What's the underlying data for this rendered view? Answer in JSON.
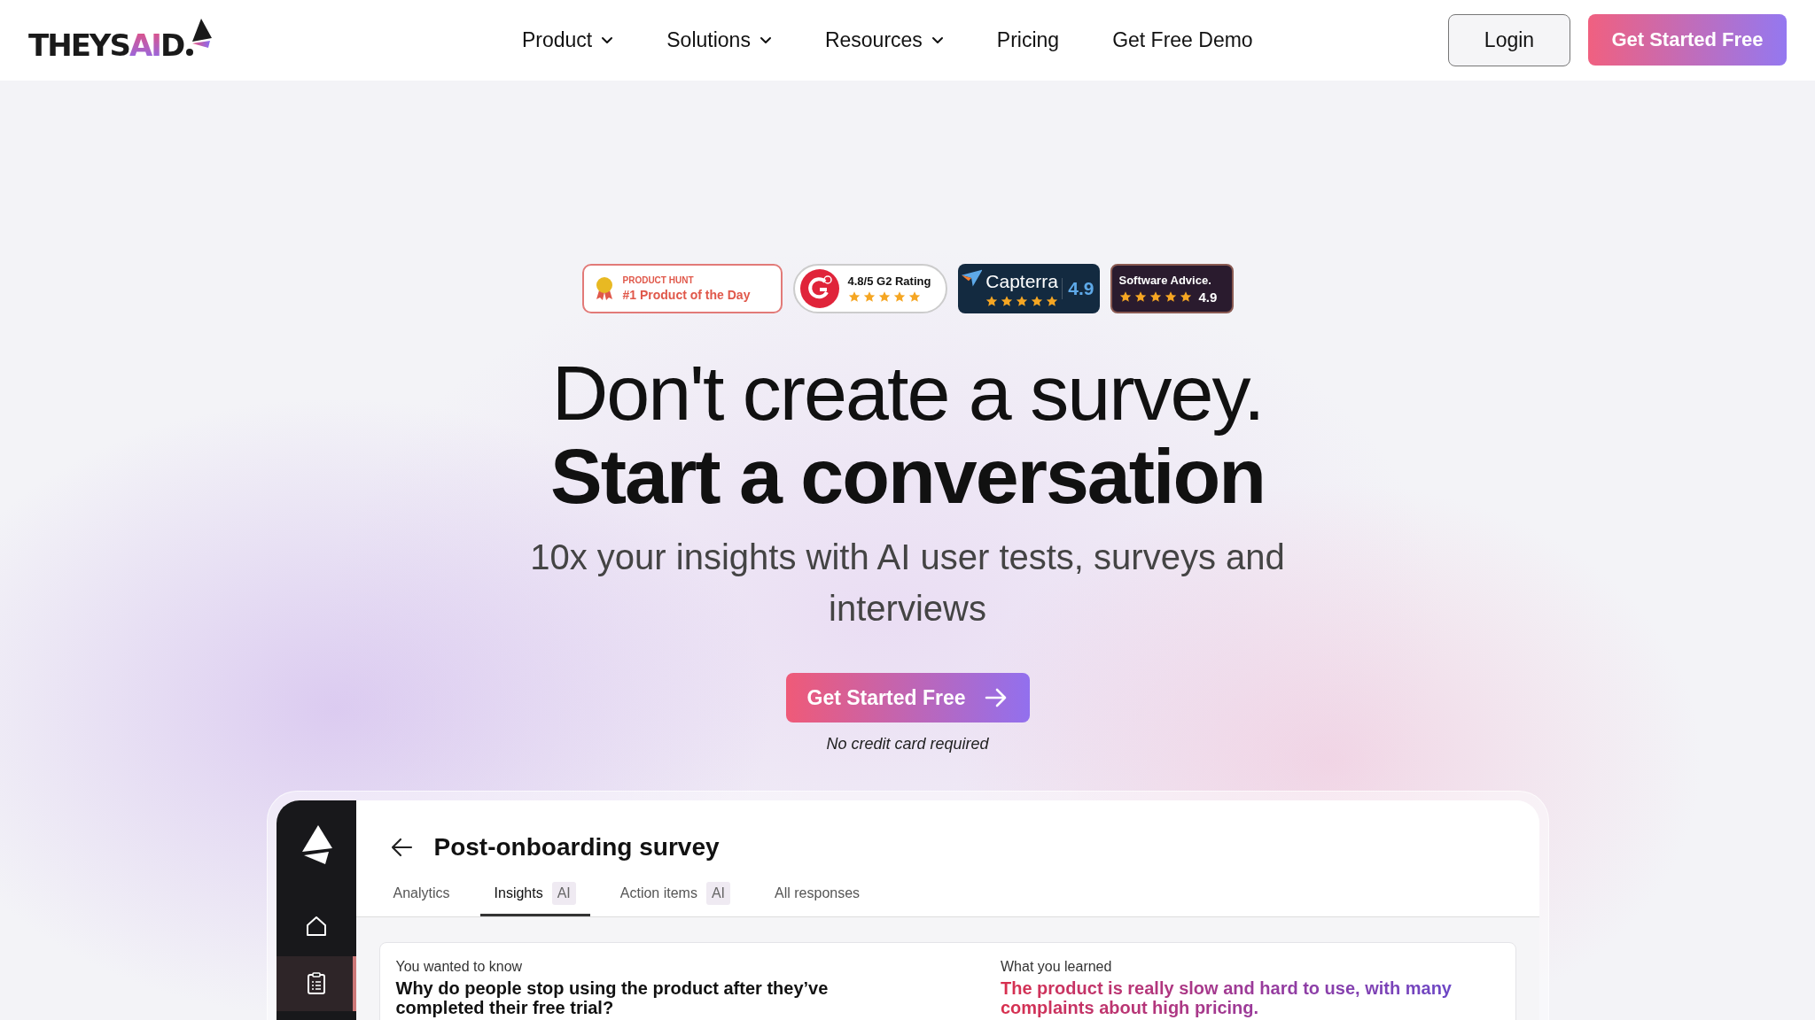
{
  "header": {
    "logo": [
      {
        "text": "THEYS",
        "accent": false
      },
      {
        "text": "AI",
        "accent": true
      },
      {
        "text": "D",
        "accent": false
      }
    ],
    "nav": [
      {
        "label": "Product",
        "dropdown": true
      },
      {
        "label": "Solutions",
        "dropdown": true
      },
      {
        "label": "Resources",
        "dropdown": true
      },
      {
        "label": "Pricing",
        "dropdown": false
      },
      {
        "label": "Get Free Demo",
        "dropdown": false
      }
    ],
    "login": "Login",
    "cta": "Get Started Free"
  },
  "badges": [
    {
      "kind": "product-hunt",
      "title": "PRODUCT HUNT",
      "text": "#1 Product of the Day"
    },
    {
      "kind": "g2",
      "title": "4.8/5 G2 Rating",
      "stars": 5
    },
    {
      "kind": "capterra",
      "title": "Capterra",
      "score": "4.9",
      "stars": 5
    },
    {
      "kind": "software-advice",
      "title": "Software Advice.",
      "score": "4.9",
      "stars": 5
    }
  ],
  "hero": {
    "title": "Don't create a survey.",
    "subtitle": "Start a conversation",
    "description": "10x your insights with AI user tests, surveys and interviews",
    "cta": "Get Started Free",
    "note": "No credit card required"
  },
  "app": {
    "sidebar": [
      {
        "kind": "home",
        "selected": false
      },
      {
        "kind": "clipboard",
        "selected": true
      }
    ],
    "title": "Post-onboarding survey",
    "tabs": [
      {
        "label": "Analytics",
        "selected": false
      },
      {
        "label": "Insights",
        "tag": "AI",
        "selected": true
      },
      {
        "label": "Action items",
        "tag": "AI",
        "selected": false
      },
      {
        "label": "All responses",
        "selected": false
      }
    ],
    "cards": [
      {
        "kind": "question",
        "label": "You wanted to know",
        "text": "Why do people stop using the product after they’ve completed their free trial?"
      },
      {
        "kind": "answer",
        "label": "What you learned",
        "text": "The product is really slow and hard to use, with many complaints about high pricing."
      }
    ]
  }
}
